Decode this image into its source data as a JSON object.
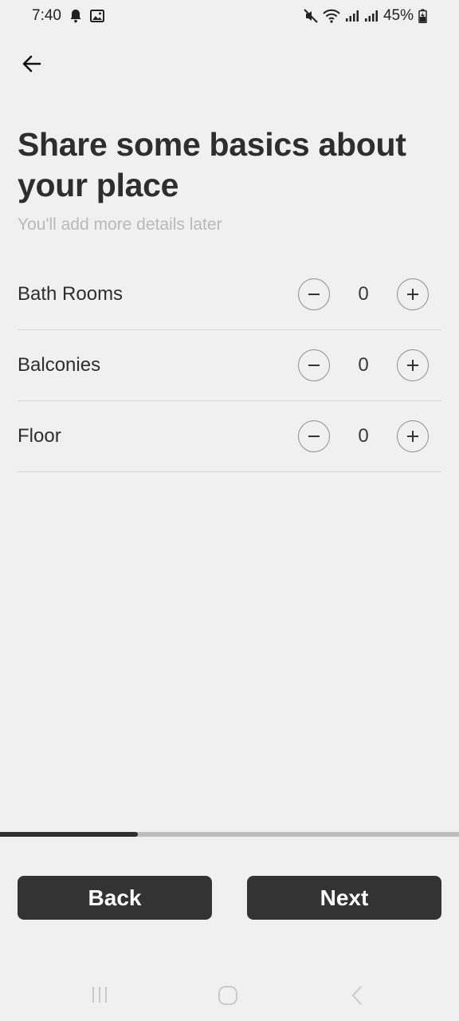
{
  "status_bar": {
    "time": "7:40",
    "battery": "45%",
    "icons": [
      "notification-bell-icon",
      "image-icon",
      "mute-icon",
      "wifi-icon",
      "signal-icon",
      "signal-icon",
      "battery-charging-icon"
    ]
  },
  "header": {
    "back_icon": "arrow-left-icon",
    "title": "Share some basics about your place",
    "subtitle": "You'll add more details later"
  },
  "rows": [
    {
      "label": "Bath Rooms",
      "value": "0"
    },
    {
      "label": "Balconies",
      "value": "0"
    },
    {
      "label": "Floor",
      "value": "0"
    }
  ],
  "progress": {
    "fraction": 0.3
  },
  "footer": {
    "back_label": "Back",
    "next_label": "Next"
  },
  "nav_bar": {
    "icons": [
      "recent-apps-icon",
      "home-icon",
      "back-nav-icon"
    ]
  },
  "colors": {
    "background": "#f0f0f0",
    "button": "#333333",
    "subtitle": "#b9b9b9"
  }
}
